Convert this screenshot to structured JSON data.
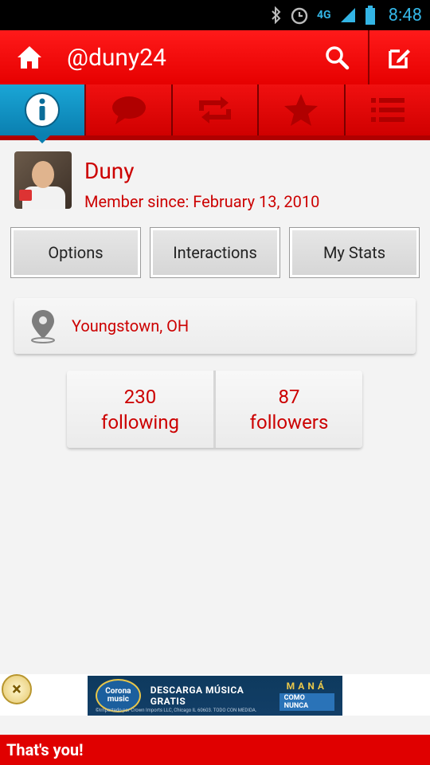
{
  "status_bar": {
    "time": "8:48",
    "network": "4G",
    "icons": [
      "bluetooth-icon",
      "alarm-icon",
      "network-4g-icon",
      "signal-icon",
      "battery-icon"
    ]
  },
  "action_bar": {
    "title": "@duny24",
    "icons": [
      "home-icon",
      "search-icon",
      "compose-icon"
    ],
    "color": "#e60000"
  },
  "tabs": [
    {
      "name": "info",
      "icon": "info-icon",
      "active": true
    },
    {
      "name": "conversations",
      "icon": "speech-bubble-icon",
      "active": false
    },
    {
      "name": "retweets",
      "icon": "retweet-icon",
      "active": false
    },
    {
      "name": "favorites",
      "icon": "star-icon",
      "active": false
    },
    {
      "name": "lists",
      "icon": "list-icon",
      "active": false
    }
  ],
  "profile": {
    "name": "Duny",
    "member_since": "Member since: February 13, 2010"
  },
  "buttons": {
    "options": "Options",
    "interactions": "Interactions",
    "my_stats": "My Stats"
  },
  "location": {
    "place": "Youngstown, OH",
    "icon": "location-pin-icon"
  },
  "stats": {
    "following_count": "230",
    "following_label": "following",
    "followers_count": "87",
    "followers_label": "followers"
  },
  "ad": {
    "logo_line1": "Corona",
    "logo_line2": "music",
    "headline": "DESCARGA MÚSICA GRATIS",
    "brand": "MANÁ",
    "brand_sub": "COMO NUNCA",
    "fine_print": "©Importado por Crown Imports LLC, Chicago IL 60603. TODO CON MEDIDA."
  },
  "footer": {
    "message": "That's you!"
  },
  "colors": {
    "accent_red": "#cc0000",
    "tab_active_blue": "#0a7fb0",
    "status_blue": "#33b5e5"
  }
}
